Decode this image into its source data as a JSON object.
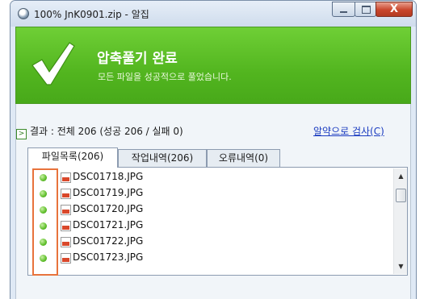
{
  "window": {
    "title": "100% JnK0901.zip - 알집",
    "close_label": "X"
  },
  "banner": {
    "title": "압축풀기 완료",
    "subtitle": "모든 파일을 성공적으로 풀었습니다."
  },
  "result": {
    "arrow": ">",
    "text": "결과 : 전체 206 (성공 206 / 실패 0)",
    "search_link": "알약으로 검사(C)"
  },
  "tabs": [
    {
      "label": "파일목록(206)",
      "active": true
    },
    {
      "label": "작업내역(206)",
      "active": false
    },
    {
      "label": "오류내역(0)",
      "active": false
    }
  ],
  "files": [
    {
      "name": "DSC01718.JPG",
      "status": "success",
      "icon": "jpg-file-icon"
    },
    {
      "name": "DSC01719.JPG",
      "status": "success",
      "icon": "jpg-file-icon"
    },
    {
      "name": "DSC01720.JPG",
      "status": "success",
      "icon": "jpg-file-icon"
    },
    {
      "name": "DSC01721.JPG",
      "status": "success",
      "icon": "jpg-file-icon"
    },
    {
      "name": "DSC01722.JPG",
      "status": "success",
      "icon": "jpg-file-icon"
    },
    {
      "name": "DSC01723.JPG",
      "status": "success",
      "icon": "jpg-file-icon"
    }
  ],
  "scrollbar": {
    "up": "▲",
    "down": "▼"
  },
  "colors": {
    "banner_green": "#52b51f",
    "status_dot": "#5fbf2b",
    "highlight": "#e8733c",
    "link": "#1a3bc0"
  }
}
